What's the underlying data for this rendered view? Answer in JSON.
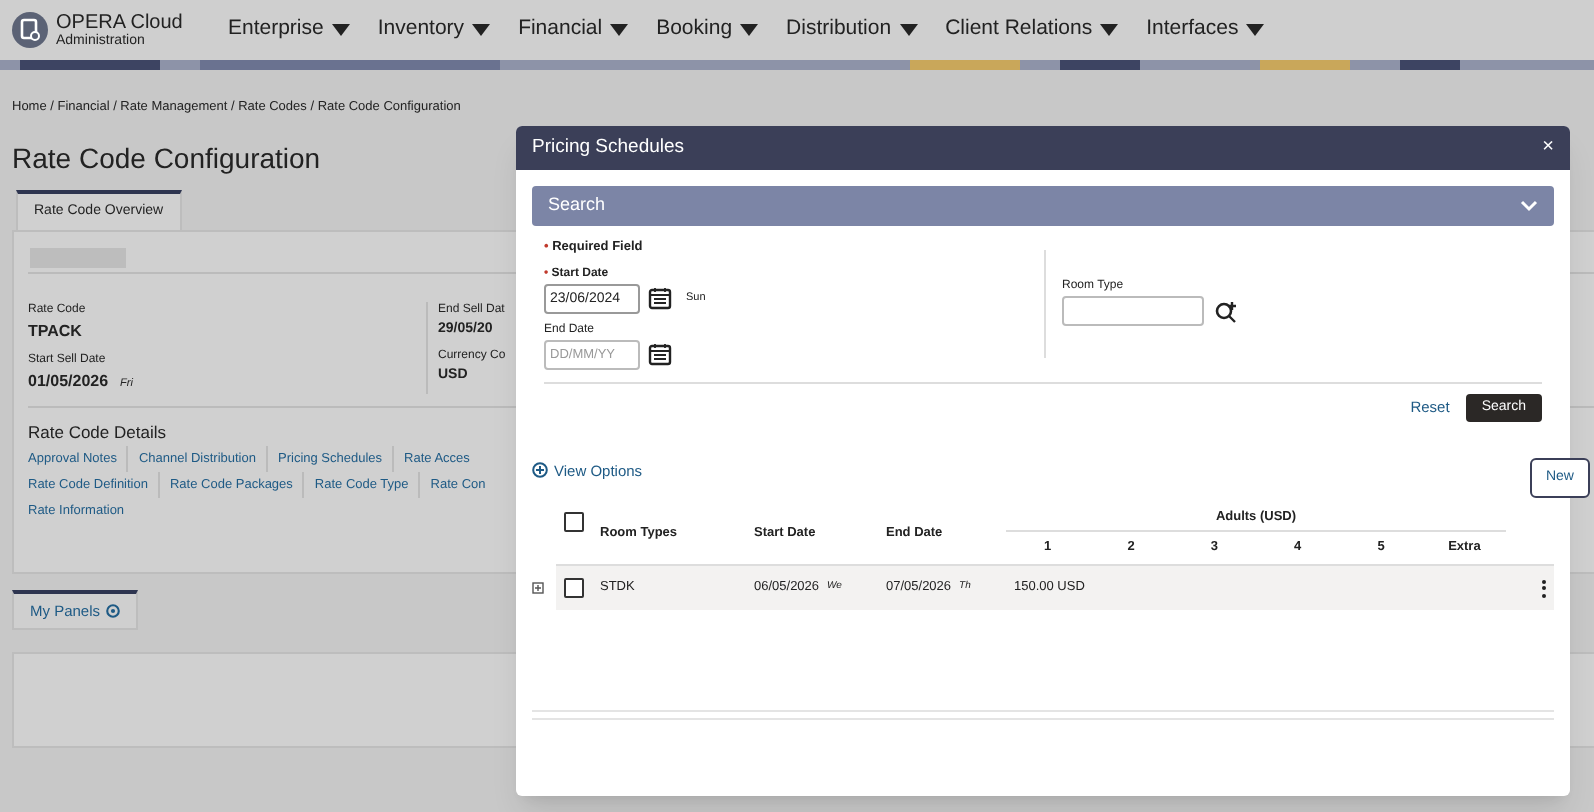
{
  "app": {
    "name": "OPERA Cloud",
    "subtitle": "Administration"
  },
  "menu": [
    {
      "label": "Enterprise"
    },
    {
      "label": "Inventory"
    },
    {
      "label": "Financial"
    },
    {
      "label": "Booking"
    },
    {
      "label": "Distribution"
    },
    {
      "label": "Client Relations"
    },
    {
      "label": "Interfaces"
    }
  ],
  "breadcrumb": "Home / Financial / Rate Management / Rate Codes / Rate Code Configuration",
  "page_title": "Rate Code Configuration",
  "tabs": [
    {
      "label": "Rate Code Overview",
      "selected": true
    }
  ],
  "overview": {
    "fields": [
      {
        "label": "Rate Code",
        "value": "TPACK"
      },
      {
        "label": "Start Sell Date",
        "value": "01/05/2026",
        "day": "Fri"
      }
    ],
    "fields_right": [
      {
        "label": "End Sell Dat",
        "value": "29/05/20"
      },
      {
        "label": "Currency Co",
        "value": "USD"
      }
    ],
    "details_title": "Rate Code Details",
    "links": [
      [
        "Approval Notes",
        "Channel Distribution",
        "Pricing Schedules",
        "Rate Acces"
      ],
      [
        "Rate Code Definition",
        "Rate Code Packages",
        "Rate Code Type",
        "Rate Con"
      ],
      [
        "Rate Information"
      ]
    ]
  },
  "panels_tab": {
    "label": "My Panels",
    "selected": true
  },
  "dialog": {
    "title": "Pricing Schedules",
    "search_title": "Search",
    "required_note": "Required Field",
    "start_date": {
      "label": "Start Date",
      "value": "23/06/2024",
      "day": "Sun"
    },
    "end_date": {
      "label": "End Date",
      "placeholder": "DD/MM/YY"
    },
    "room_type": {
      "label": "Room Type"
    },
    "reset": "Reset",
    "search": "Search",
    "view_options": "View Options",
    "table": {
      "columns": [
        "Room Types",
        "Start Date",
        "End Date"
      ],
      "group": "Adults (USD)",
      "sub_columns": [
        "1",
        "2",
        "3",
        "4",
        "5",
        "Extra"
      ],
      "rows": [
        {
          "checked": false,
          "room_type": "STDK",
          "start": "06/05/2026",
          "start_day": "We",
          "end": "07/05/2026",
          "end_day": "Th",
          "prices": [
            "150.00 USD"
          ]
        }
      ],
      "all_checked": false
    },
    "close": "×",
    "required_mark": "•"
  },
  "tooltip": "New"
}
